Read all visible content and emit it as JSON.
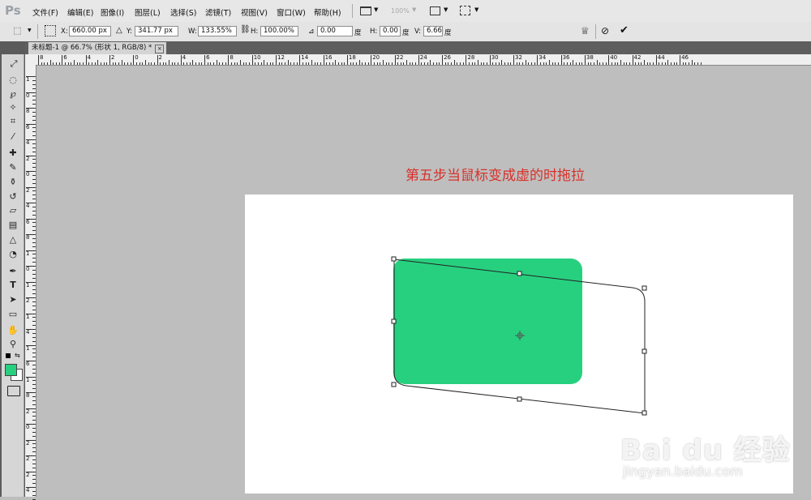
{
  "app": {
    "logo": "Ps"
  },
  "menu": [
    "文件(F)",
    "编辑(E)",
    "图像(I)",
    "图层(L)",
    "选择(S)",
    "滤镜(T)",
    "视图(V)",
    "窗口(W)",
    "帮助(H)"
  ],
  "appbar": {
    "zoom": "100%"
  },
  "options": {
    "x_label": "X:",
    "x_value": "660.00 px",
    "y_label": "Y:",
    "y_value": "341.77 px",
    "w_label": "W:",
    "w_value": "133.55%",
    "h_label": "H:",
    "h_value": "100.00%",
    "angle_value": "0.00",
    "angle_unit": "度",
    "hskew_label": "H:",
    "hskew_value": "0.00",
    "hskew_unit": "度",
    "vskew_label": "V:",
    "vskew_value": "6.66",
    "vskew_unit": "度"
  },
  "document": {
    "tab_title": "未标题-1 @ 66.7% (形状 1, RGB/8) *",
    "instruction_text": "第五步当鼠标变成虚的时拖拉",
    "shape_color": "#27d07f"
  },
  "rulers": {
    "horizontal": [
      "8",
      "6",
      "4",
      "2",
      "0",
      "2",
      "4",
      "6",
      "8",
      "10",
      "12",
      "14",
      "16",
      "18",
      "20",
      "22",
      "24",
      "26",
      "28",
      "30",
      "32",
      "34",
      "36",
      "38",
      "40",
      "42",
      "44",
      "46"
    ],
    "vertical": [
      "1",
      "0",
      "8",
      "6",
      "4",
      "2",
      "0",
      "2",
      "4",
      "6",
      "8",
      "1",
      "0",
      "1",
      "2",
      "1",
      "4",
      "1",
      "6",
      "1",
      "8",
      "2",
      "0",
      "2",
      "2",
      "2",
      "4"
    ]
  },
  "colors": {
    "foreground": "#27d07f",
    "background": "#ffffff"
  },
  "watermark": {
    "brand": "Bai du 经验",
    "url": "jingyan.baidu.com"
  }
}
